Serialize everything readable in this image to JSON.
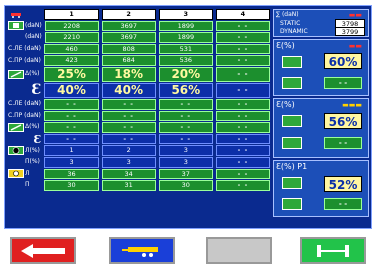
{
  "header": {
    "col1": "1",
    "col2": "2",
    "col3": "3",
    "col4": "4"
  },
  "units": {
    "dan": "(daN)",
    "le_dan": "С.ЛЕ (daN)",
    "pr_dan": "С.ПР (daN)",
    "delta": "Δ(%)",
    "eps": "Ɛ",
    "eps_pct": "Ɛ(%)",
    "pi_pct": "Π(%)",
    "mi_pct": "Л(%)",
    "ii": "Л",
    "pi": "Π"
  },
  "rows": {
    "r1": [
      "2208",
      "3697",
      "1899",
      "- -"
    ],
    "r2": [
      "2210",
      "3697",
      "1899",
      "- -"
    ],
    "r3": [
      "460",
      "808",
      "531",
      "- -"
    ],
    "r4": [
      "423",
      "684",
      "536",
      "- -"
    ],
    "r5": [
      "25%",
      "18%",
      "20%",
      "- -"
    ],
    "r6": [
      "40%",
      "40%",
      "56%",
      "- -"
    ],
    "r7": [
      "- -",
      "- -",
      "- -",
      "- -"
    ],
    "r8": [
      "- -",
      "- -",
      "- -",
      "- -"
    ],
    "r9": [
      "- -",
      "- -",
      "- -",
      "- -"
    ],
    "r10": [
      "- -",
      "- -",
      "- -",
      "- -"
    ],
    "r11": [
      "1",
      "2",
      "3",
      "- -"
    ],
    "r12": [
      "3",
      "3",
      "3",
      "- -"
    ],
    "r13": [
      "36",
      "34",
      "37",
      "- -"
    ],
    "r14": [
      "30",
      "31",
      "30",
      "- -"
    ]
  },
  "summary": {
    "sum_label": "∑ (daN)",
    "static_label": "STATIC",
    "static_value": "3798",
    "dynamic_label": "DYNAMIC",
    "dynamic_value": "3799"
  },
  "panels": {
    "p1": {
      "title": "Ɛ(%)",
      "value": "60%",
      "dash": "- -"
    },
    "p2": {
      "title": "Ɛ(%)",
      "value": "56%",
      "dash": "- -"
    },
    "p3": {
      "title": "Ɛ(%) P1",
      "value": "52%",
      "dash": "- -"
    }
  },
  "colors": {
    "bg": "#0a2a8f",
    "cell": "#1c8f2e",
    "yellow": "#fff6a0",
    "red": "#e02020"
  }
}
